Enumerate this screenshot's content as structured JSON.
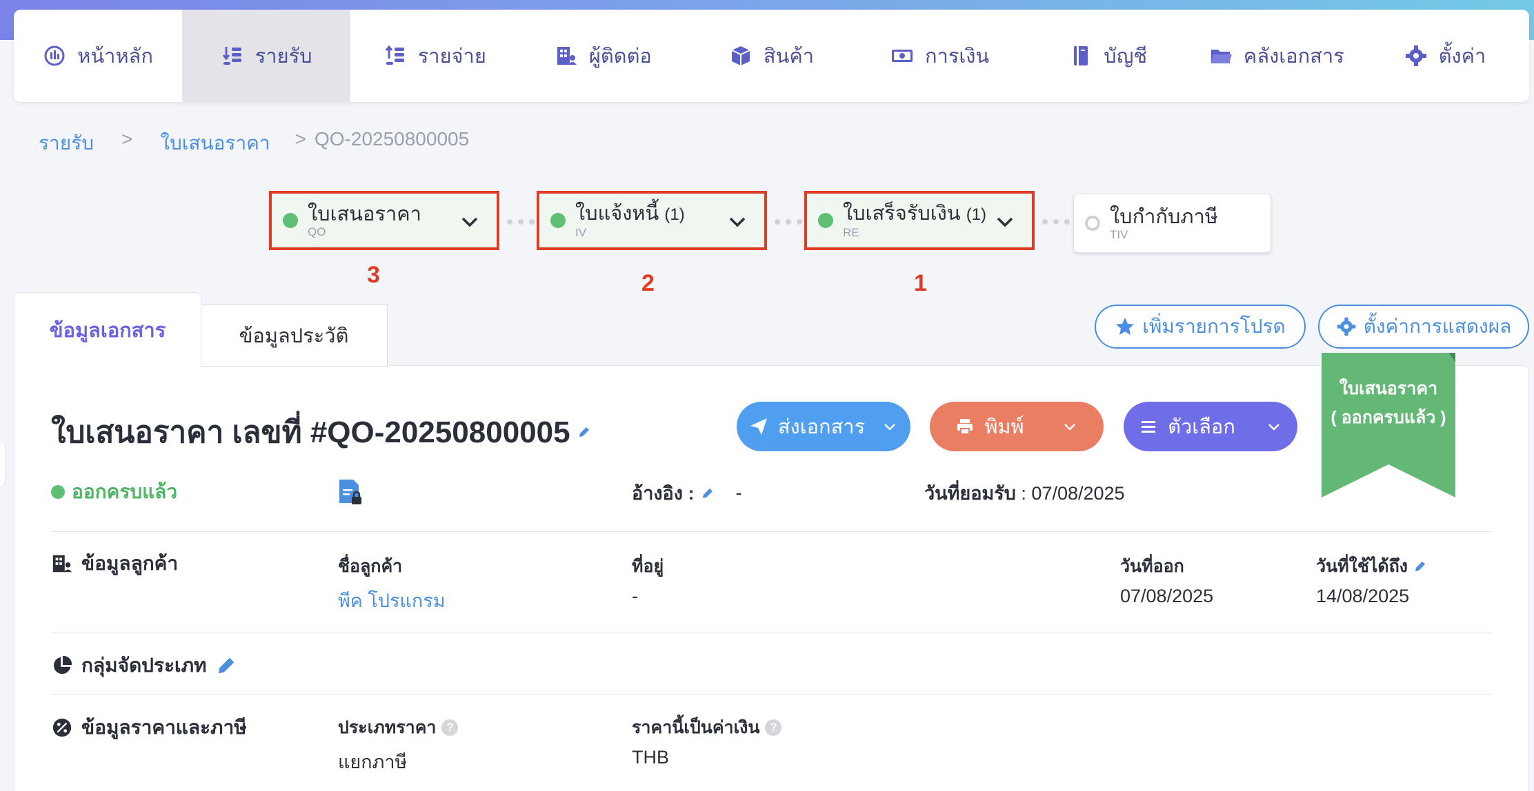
{
  "nav": {
    "items": [
      {
        "label": "หน้าหลัก",
        "icon": "dashboard-icon"
      },
      {
        "label": "รายรับ",
        "icon": "income-icon",
        "active": true
      },
      {
        "label": "รายจ่าย",
        "icon": "expense-icon"
      },
      {
        "label": "ผู้ติดต่อ",
        "icon": "contacts-icon"
      },
      {
        "label": "สินค้า",
        "icon": "product-box-icon"
      },
      {
        "label": "การเงิน",
        "icon": "money-icon"
      },
      {
        "label": "บัญชี",
        "icon": "accounting-book-icon"
      },
      {
        "label": "คลังเอกสาร",
        "icon": "folder-icon"
      },
      {
        "label": "ตั้งค่า",
        "icon": "gear-icon"
      }
    ]
  },
  "breadcrumb": {
    "level1": "รายรับ",
    "sep1": ">",
    "level2": "ใบเสนอราคา",
    "sep2": ">",
    "current": "QO-20250800005"
  },
  "flow": {
    "steps": [
      {
        "name": "ใบเสนอราคา",
        "count": "",
        "code": "QO",
        "marker": "3"
      },
      {
        "name": "ใบแจ้งหนี้",
        "count": "(1)",
        "code": "IV",
        "marker": "2"
      },
      {
        "name": "ใบเสร็จรับเงิน",
        "count": "(1)",
        "code": "RE",
        "marker": "1"
      },
      {
        "name": "ใบกำกับภาษี",
        "count": "",
        "code": "TIV"
      }
    ]
  },
  "tabs": {
    "doc_info": "ข้อมูลเอกสาร",
    "history": "ข้อมูลประวัติ"
  },
  "buttons": {
    "add_favorite": "เพิ่มรายการโปรด",
    "display_settings": "ตั้งค่าการแสดงผล",
    "send": "ส่งเอกสาร",
    "print": "พิมพ์",
    "options": "ตัวเลือก"
  },
  "colors": {
    "send": "#4f9ef0",
    "print": "#ea7e62",
    "options": "#6f6ee8",
    "ribbon": "#62b874",
    "highlight_border": "#e03c25"
  },
  "document": {
    "title": "ใบเสนอราคา เลขที่ #QO-20250800005",
    "status": "ออกครบแล้ว",
    "ribbon_line1": "ใบเสนอราคา",
    "ribbon_line2": "( ออกครบแล้ว )",
    "reference_label": "อ้างอิง :",
    "reference_value": "-",
    "accepted_label": "วันที่ยอมรับ",
    "accepted_value": ": 07/08/2025"
  },
  "customer": {
    "section_title": "ข้อมูลลูกค้า",
    "name_label": "ชื่อลูกค้า",
    "name_value": "พีค โปรแกรม",
    "address_label": "ที่อยู่",
    "address_value": "-",
    "issue_date_label": "วันที่ออก",
    "issue_date_value": "07/08/2025",
    "valid_until_label": "วันที่ใช้ได้ถึง",
    "valid_until_value": "14/08/2025"
  },
  "category": {
    "section_title": "กลุ่มจัดประเภท"
  },
  "pricing": {
    "section_title": "ข้อมูลราคาและภาษี",
    "price_type_label": "ประเภทราคา",
    "price_type_value": "แยกภาษี",
    "currency_label": "ราคานี้เป็นค่าเงิน",
    "currency_value": "THB"
  }
}
